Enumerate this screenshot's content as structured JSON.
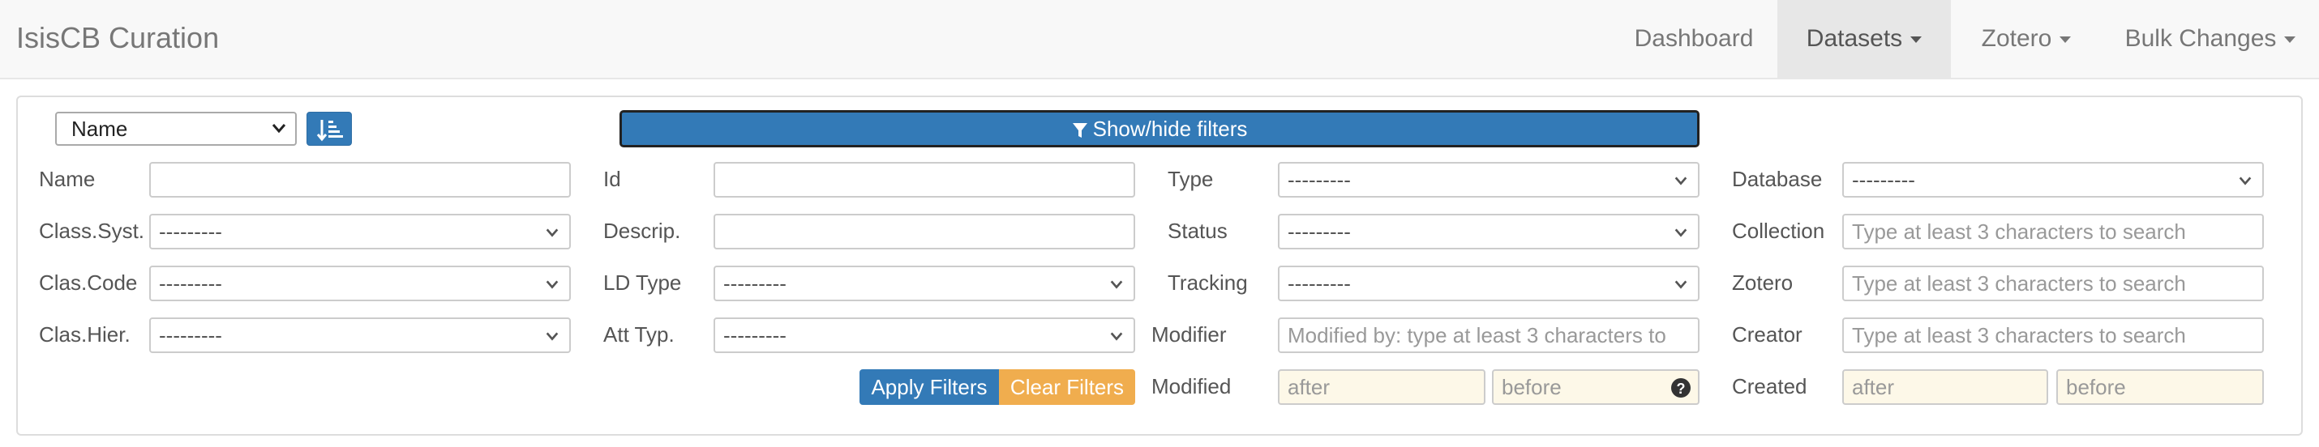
{
  "navbar": {
    "brand": "IsisCB Curation",
    "items": [
      {
        "label": "Dashboard"
      },
      {
        "label": "Datasets"
      },
      {
        "label": "Zotero"
      },
      {
        "label": "Bulk Changes"
      }
    ]
  },
  "toolbar": {
    "sort_value": "Name",
    "toggle_label": "Show/hide filters"
  },
  "filters": {
    "col1": {
      "name_label": "Name",
      "classsyst_label": "Class.Syst.",
      "classsyst_value": "---------",
      "clascode_label": "Clas.Code",
      "clascode_value": "---------",
      "clashier_label": "Clas.Hier.",
      "clashier_value": "---------"
    },
    "col2": {
      "id_label": "Id",
      "descrip_label": "Descrip.",
      "ldtype_label": "LD Type",
      "ldtype_value": "---------",
      "atttyp_label": "Att Typ.",
      "atttyp_value": "---------"
    },
    "col3": {
      "type_label": "Type",
      "type_value": "---------",
      "status_label": "Status",
      "status_value": "---------",
      "tracking_label": "Tracking",
      "tracking_value": "---------",
      "modifier_label": "Modifier",
      "modifier_placeholder": "Modified by: type at least 3 characters to",
      "modified_label": "Modified",
      "modified_after": "after",
      "modified_before": "before"
    },
    "col4": {
      "database_label": "Database",
      "database_value": "---------",
      "collection_label": "Collection",
      "collection_placeholder": "Type at least 3 characters to search",
      "zotero_label": "Zotero",
      "zotero_placeholder": "Type at least 3 characters to search",
      "creator_label": "Creator",
      "creator_placeholder": "Type at least 3 characters to search",
      "created_label": "Created",
      "created_after": "after",
      "created_before": "before"
    },
    "apply_label": "Apply Filters",
    "clear_label": "Clear Filters"
  }
}
